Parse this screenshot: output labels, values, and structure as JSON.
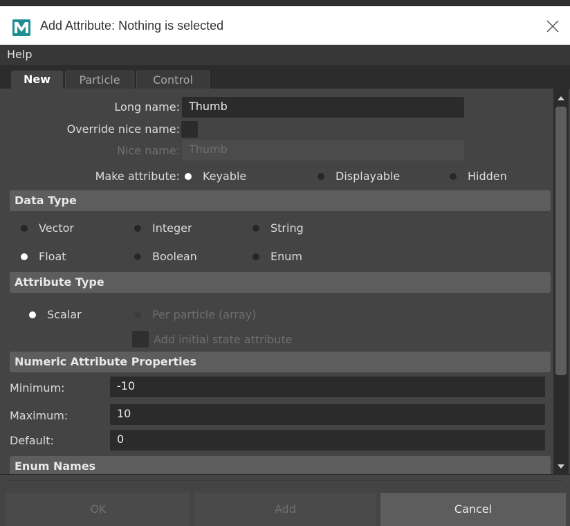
{
  "window": {
    "title": "Add Attribute: Nothing is selected",
    "app_icon": "maya-icon",
    "close_icon": "close-icon"
  },
  "menu": {
    "help": "Help"
  },
  "tabs": [
    {
      "label": "New",
      "selected": true
    },
    {
      "label": "Particle",
      "selected": false
    },
    {
      "label": "Control",
      "selected": false
    }
  ],
  "attribute": {
    "long_name_label": "Long name:",
    "long_name_value": "Thumb",
    "override_label": "Override nice name:",
    "override_checked": false,
    "nice_name_label": "Nice name:",
    "nice_name_value": "Thumb",
    "make_attribute_label": "Make attribute:",
    "make_attribute_options": [
      {
        "label": "Keyable",
        "selected": true
      },
      {
        "label": "Displayable",
        "selected": false
      },
      {
        "label": "Hidden",
        "selected": false
      }
    ]
  },
  "data_type": {
    "header": "Data Type",
    "options": [
      {
        "label": "Vector",
        "selected": false
      },
      {
        "label": "Integer",
        "selected": false
      },
      {
        "label": "String",
        "selected": false
      },
      {
        "label": "Float",
        "selected": true
      },
      {
        "label": "Boolean",
        "selected": false
      },
      {
        "label": "Enum",
        "selected": false
      }
    ]
  },
  "attribute_type": {
    "header": "Attribute Type",
    "scalar_label": "Scalar",
    "scalar_selected": true,
    "per_particle_label": "Per particle (array)",
    "initial_state_label": "Add initial state attribute"
  },
  "numeric": {
    "header": "Numeric Attribute Properties",
    "minimum_label": "Minimum:",
    "minimum_value": "-10",
    "maximum_label": "Maximum:",
    "maximum_value": "10",
    "default_label": "Default:",
    "default_value": "0"
  },
  "enum_names": {
    "header": "Enum Names"
  },
  "buttons": {
    "ok": "OK",
    "add": "Add",
    "cancel": "Cancel"
  }
}
